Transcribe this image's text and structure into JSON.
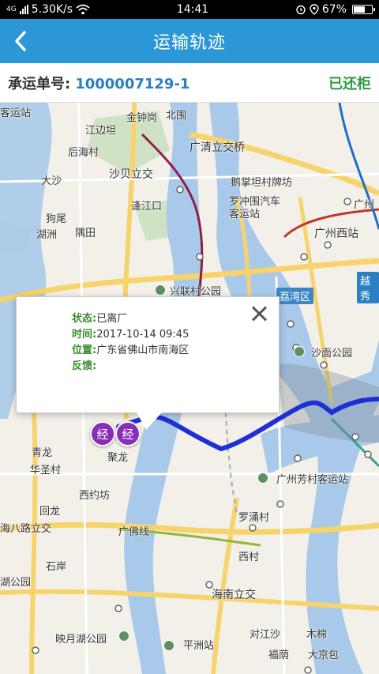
{
  "status_bar": {
    "network": "4G",
    "speed": "5.30K/s",
    "time": "14:41",
    "battery": "67%",
    "battery_level": 0.67
  },
  "header": {
    "title": "运输轨迹",
    "back_icon": "chevron-left-icon"
  },
  "order": {
    "label": "承运单号:",
    "number": "1000007129-1",
    "status": "已还柜"
  },
  "map": {
    "route_color": "#1f2fd6",
    "places": [
      "客运站",
      "金钟岗",
      "北围",
      "江边坦",
      "后海村",
      "广清立交桥",
      "大沙",
      "沙贝立交",
      "鹅掌坦村牌坊",
      "逢江口",
      "罗冲围汽车",
      "客运站",
      "狗尾",
      "湖洲",
      "隅田",
      "广州西站",
      "兴联村公园",
      "荔湾区",
      "沙面公园",
      "青龙",
      "华圣村",
      "聚龙",
      "西约坊",
      "广州芳村客运站",
      "回龙",
      "海八路立交",
      "罗涌村",
      "广佛线",
      "西村",
      "石岸",
      "湖公园",
      "海南立交",
      "映月湖公园",
      "对江沙",
      "木棉",
      "平洲站",
      "福荫",
      "大京包",
      "广州",
      "越秀"
    ],
    "markers": [
      "经",
      "经"
    ]
  },
  "popup": {
    "status_label": "状态:",
    "status_value": "已离厂",
    "time_label": "时间:",
    "time_value": "2017-10-14 09:45",
    "location_label": "位置:",
    "location_value": "广东省佛山市南海区",
    "feedback_label": "反馈:",
    "feedback_value": ""
  }
}
